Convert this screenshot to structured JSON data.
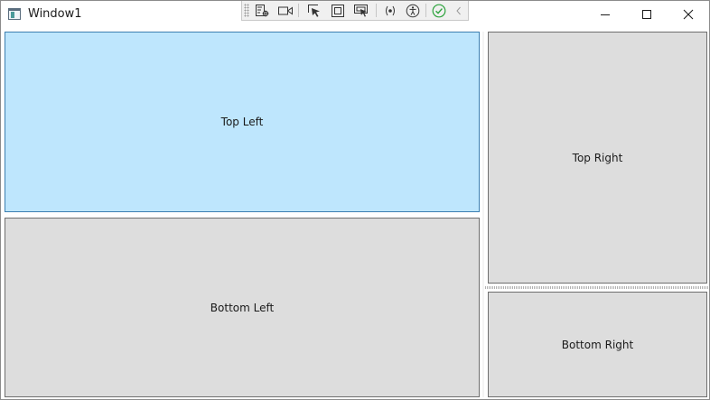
{
  "window": {
    "title": "Window1",
    "icon": "window-app-icon"
  },
  "caption_buttons": {
    "minimize_icon": "minimize-icon",
    "maximize_icon": "maximize-icon",
    "close_icon": "close-icon"
  },
  "toolbar": {
    "items": [
      "live-visual-tree-icon",
      "record-video-icon",
      "select-element-icon",
      "display-layout-adorners-icon",
      "track-focused-element-icon",
      "binding-failures-icon",
      "accessibility-scanner-icon",
      "hot-reload-ok-icon",
      "collapse-toolbar-icon"
    ],
    "accent_green": "#2ca33c"
  },
  "panels": {
    "top_left": "Top Left",
    "bottom_left": "Bottom Left",
    "top_right": "Top Right",
    "bottom_right": "Bottom Right"
  },
  "colors": {
    "selected_fill": "#bee6fd",
    "selected_border": "#3c7fb1",
    "panel_fill": "#dddddd"
  }
}
